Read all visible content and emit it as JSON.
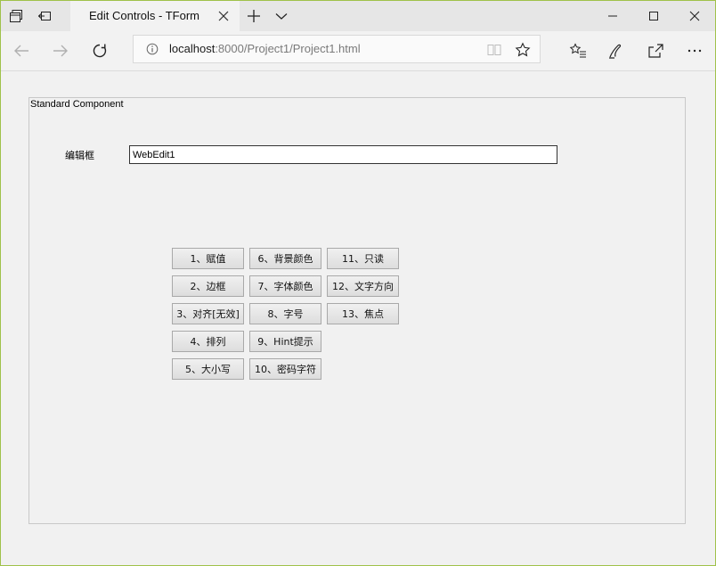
{
  "browser": {
    "tab_title": "Edit Controls - TForm",
    "address": {
      "host": "localhost",
      "rest": ":8000/Project1/Project1.html"
    }
  },
  "page": {
    "group_caption": "Standard Component",
    "edit_label": "编辑框",
    "edit_value": "WebEdit1",
    "buttons": {
      "b1": "1、赋值",
      "b2": "2、边框",
      "b3": "3、对齐[无效]",
      "b4": "4、排列",
      "b5": "5、大小写",
      "b6": "6、背景颜色",
      "b7": "7、字体颜色",
      "b8": "8、字号",
      "b9": "9、Hint提示",
      "b10": "10、密码字符",
      "b11": "11、只读",
      "b12": "12、文字方向",
      "b13": "13、焦点"
    }
  }
}
